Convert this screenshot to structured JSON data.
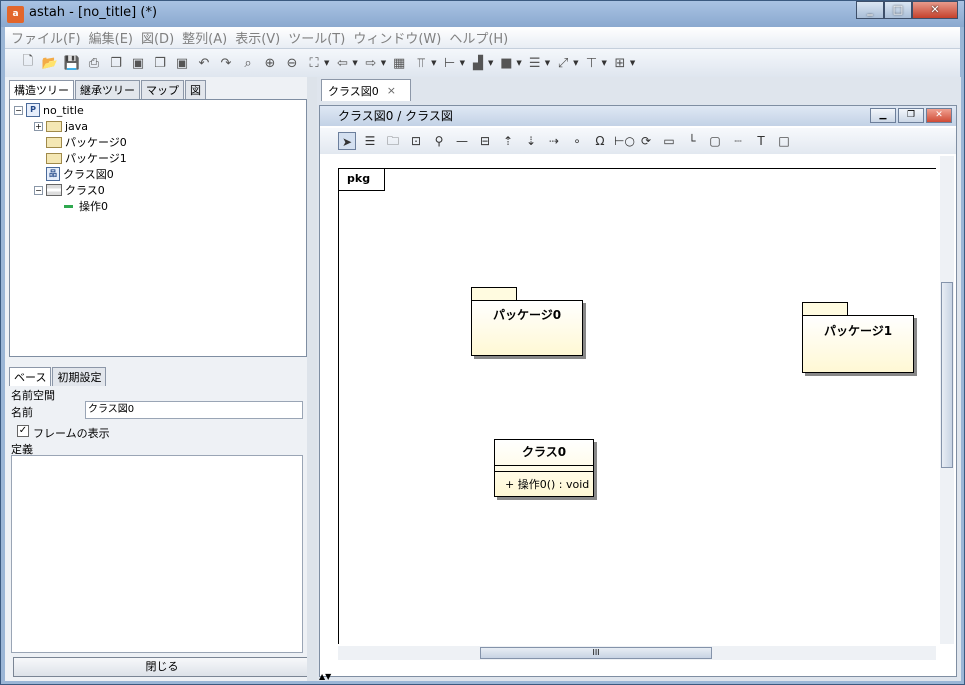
{
  "window": {
    "title": "astah - [no_title] (*)"
  },
  "app_icon_text": "a",
  "menu": [
    "ファイル(F)",
    "編集(E)",
    "図(D)",
    "整列(A)",
    "表示(V)",
    "ツール(T)",
    "ウィンドウ(W)",
    "ヘルプ(H)"
  ],
  "left_tabs": [
    "構造ツリー",
    "継承ツリー",
    "マップ",
    "図"
  ],
  "tree": {
    "root": "no_title",
    "java": "java",
    "pkg0": "パッケージ0",
    "pkg1": "パッケージ1",
    "diagram": "クラス図0",
    "class": "クラス0",
    "op": "操作0"
  },
  "props": {
    "tabs": [
      "ベース",
      "初期設定"
    ],
    "namespace_label": "名前空間",
    "name_label": "名前",
    "name_value": "クラス図0",
    "frame_label": "フレームの表示",
    "frame_checked": "✓",
    "definition_label": "定義"
  },
  "close_button": "閉じる",
  "doc_tab": {
    "label": "クラス図0",
    "close": "×"
  },
  "diagram_window": {
    "title": "クラス図0 / クラス図"
  },
  "canvas": {
    "frame_label": "pkg",
    "package0": "パッケージ0",
    "package1": "パッケージ1",
    "class_name": "クラス0",
    "class_op": "+ 操作0() : void"
  },
  "scroll_glyph": "III"
}
